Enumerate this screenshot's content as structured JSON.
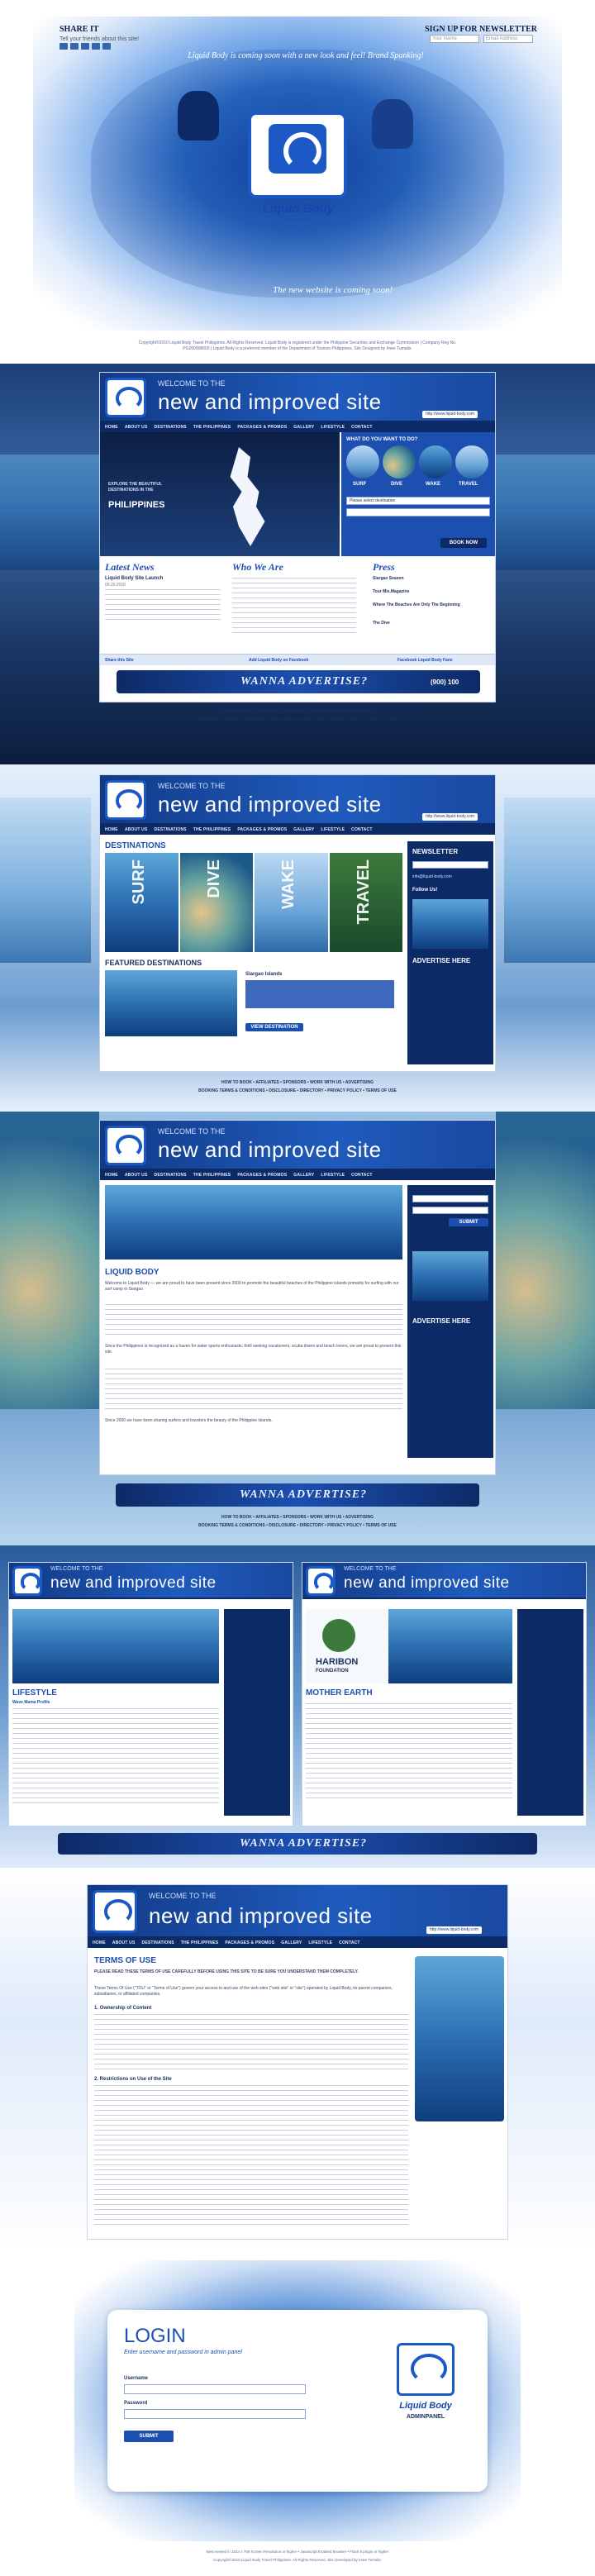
{
  "splash": {
    "share_title": "SHARE IT",
    "share_sub": "Tell your friends about this site!",
    "newsletter_title": "SIGN UP FOR NEWSLETTER",
    "newsletter_name_placeholder": "Your Name",
    "newsletter_email_placeholder": "Email Address",
    "tagline_top": "Liquid Body is coming soon with a new look and feel! Brand Spanking!",
    "logo_text": "Liquid Body",
    "tagline_bottom": "The new website is coming soon!",
    "footer": "Copyright©2010 Liquid Body Travel Philippines. All Rights Reserved. Liquid Body is registered under the Philippine Securities and Exchange Commission | Company Reg No. PG200908000 | Liquid Body is a preferred member of the Department of Tourism Philippines. Site Designed by Imee Tumalis."
  },
  "site": {
    "welcome": "WELCOME TO THE",
    "headline": "new and improved site",
    "url": "http://www.liquid-body.com",
    "nav": [
      "HOME",
      "ABOUT US",
      "DESTINATIONS",
      "THE PHILIPPINES",
      "PACKAGES & PROMOS",
      "GALLERY",
      "LIFESTYLE",
      "CONTACT"
    ]
  },
  "home": {
    "map_caption": "EXPLORE THE BEAUTIFUL DESTINATIONS IN THE",
    "map_country": "PHILIPPINES",
    "want_title": "WHAT DO YOU WANT TO DO?",
    "activities": [
      "SURF",
      "DIVE",
      "WAKE",
      "TRAVEL"
    ],
    "search_label": "Please select destination",
    "book_button": "BOOK NOW",
    "latest_news": "Latest News",
    "news_item": "Liquid Body Site Launch",
    "news_date": "09.20.2010",
    "who_we_are": "Who We Are",
    "press": "Press",
    "press_item1": "Siargao Season",
    "press_item2": "Tour Mis.Magazine",
    "press_item3": "Where The Beaches Are Only The Beginning",
    "press_item4": "The Dive",
    "share": "Share this Site",
    "add_facebook": "Add Liquid Body on Facebook",
    "fans": "Facebook Liquid Body Fans",
    "ad": "WANNA ADVERTISE?",
    "ad_phone": "(900) 100",
    "footer_links": "HOW TO BOOK • AFFILIATES • SPONSORS • WORK WITH US • ADVERTISING",
    "footer_links2": "BOOKING TERMS & CONDITIONS • DISCLOSURE • DIRECTORY • PRIVACY POLICY • TERMS OF USE"
  },
  "destinations": {
    "title": "DESTINATIONS",
    "activities": [
      "SURF",
      "DIVE",
      "WAKE",
      "TRAVEL"
    ],
    "featured": "FEATURED DESTINATIONS",
    "feat_name": "Siargao Islands",
    "view_button": "VIEW DESTINATION",
    "newsletter": "NEWSLETTER",
    "contact": "info@liquid-body.com",
    "follow": "Follow Us!",
    "advertise": "ADVERTISE HERE"
  },
  "about": {
    "title": "LIQUID BODY",
    "p1": "Welcome to Liquid Body — we are proud to have been present since 2000 to promote the beautiful beaches of the Philippine islands primarily for surfing with our surf camp in Siargao.",
    "p2": "Since the Philippines is recognized as a haven for water sports enthusiasts, thrill seeking vacationers, scuba divers and beach lovers, we are proud to present this site.",
    "p3": "Since 2000 we have been sharing surfers and travelers the beauty of the Philippine Islands.",
    "submit": "SUBMIT",
    "advertise": "ADVERTISE HERE"
  },
  "lifestyle": {
    "title": "LIFESTYLE",
    "sub": "Wave Mama Profile",
    "haribon": "HARIBON",
    "haribon_sub": "FOUNDATION",
    "mother_earth": "MOTHER EARTH"
  },
  "terms": {
    "title": "TERMS OF USE",
    "intro": "PLEASE READ THESE TERMS OF USE CAREFULLY BEFORE USING THIS SITE TO BE SURE YOU UNDERSTAND THEM COMPLETELY.",
    "h1": "1. Ownership of Content",
    "h2": "2. Restrictions on Use of the Site",
    "body": "These Terms Of Use (\"TOU\" or \"Terms of Use\") govern your access to and use of the web sites (\"web site\" or \"site\") operated by Liquid Body, its parent companies, subsidiaries, or affiliated companies."
  },
  "login": {
    "title": "LOGIN",
    "sub": "Enter username and password in admin panel",
    "username": "Username",
    "password": "Password",
    "submit": "SUBMIT",
    "logo": "Liquid Body",
    "panel": "ADMINPANEL",
    "footer1": "Best viewed in 1024 x 768 Screen Resolution or higher • Javascript Enabled Browser • Flash 8 plugin or higher",
    "footer2": "Copyright©2010 Liquid Body Travel Philippines. All Rights Reserved. Site Developed by Imee Tumalis."
  },
  "colors": {
    "brand_blue": "#1c4fb0",
    "navy": "#0c2a66",
    "accent_light": "#e6efff"
  }
}
